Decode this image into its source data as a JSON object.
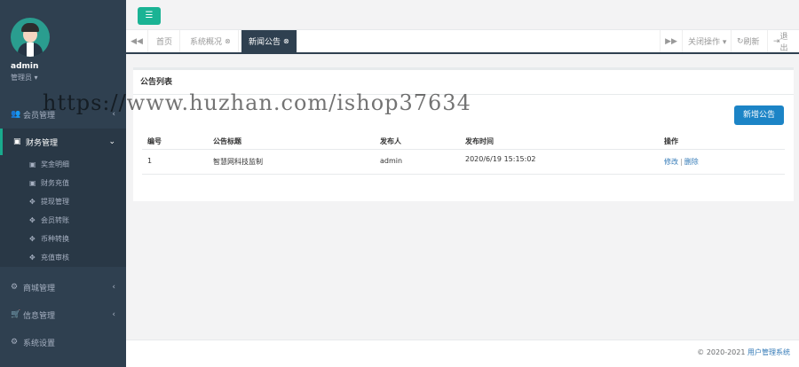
{
  "user": {
    "name": "admin",
    "role": "管理员 ▾"
  },
  "sidebar": {
    "items": [
      {
        "label": "会员管理",
        "icon": "users-icon",
        "glyph": "👥",
        "arrow": "‹"
      },
      {
        "label": "财务管理",
        "icon": "money-icon",
        "glyph": "▣",
        "arrow": "⌄"
      },
      {
        "label": "商城管理",
        "icon": "cogs-icon",
        "glyph": "⚙",
        "arrow": "‹"
      },
      {
        "label": "信息管理",
        "icon": "cart-icon",
        "glyph": "🛒",
        "arrow": "‹"
      },
      {
        "label": "系统设置",
        "icon": "gear-icon",
        "glyph": "⚙",
        "arrow": ""
      }
    ],
    "finance_sub": [
      {
        "label": "奖金明细",
        "icon": "money-icon",
        "glyph": "▣"
      },
      {
        "label": "财务充值",
        "icon": "money-icon",
        "glyph": "▣"
      },
      {
        "label": "提现管理",
        "icon": "expand-icon",
        "glyph": "✥"
      },
      {
        "label": "会员转账",
        "icon": "expand-icon",
        "glyph": "✥"
      },
      {
        "label": "币种转换",
        "icon": "expand-icon",
        "glyph": "✥"
      },
      {
        "label": "充值审核",
        "icon": "expand-icon",
        "glyph": "✥"
      }
    ]
  },
  "tabs": [
    {
      "label": "首页",
      "closable": false,
      "active": false
    },
    {
      "label": "系统概况",
      "closable": true,
      "active": false
    },
    {
      "label": "新闻公告",
      "closable": true,
      "active": true
    }
  ],
  "tab_actions": {
    "close_ops": "关闭操作 ▾",
    "refresh": "刷新",
    "logout": "退出"
  },
  "panel": {
    "title": "公告列表",
    "new_button": "新增公告",
    "columns": [
      "编号",
      "公告标题",
      "发布人",
      "发布时间",
      "操作"
    ],
    "rows": [
      {
        "id": "1",
        "title": "智慧网科技监制",
        "author": "admin",
        "time": "2020/6/19 15:15:02",
        "edit": "修改",
        "sep": "|",
        "delete": "删除"
      }
    ]
  },
  "footer": {
    "copyright": "© 2020-2021 ",
    "brand": "用户管理系统"
  },
  "watermark": "https://www.huzhan.com/ishop37634",
  "colors": {
    "sidebar": "#2f4050",
    "accent": "#1ab394",
    "primary": "#1c84c6"
  }
}
